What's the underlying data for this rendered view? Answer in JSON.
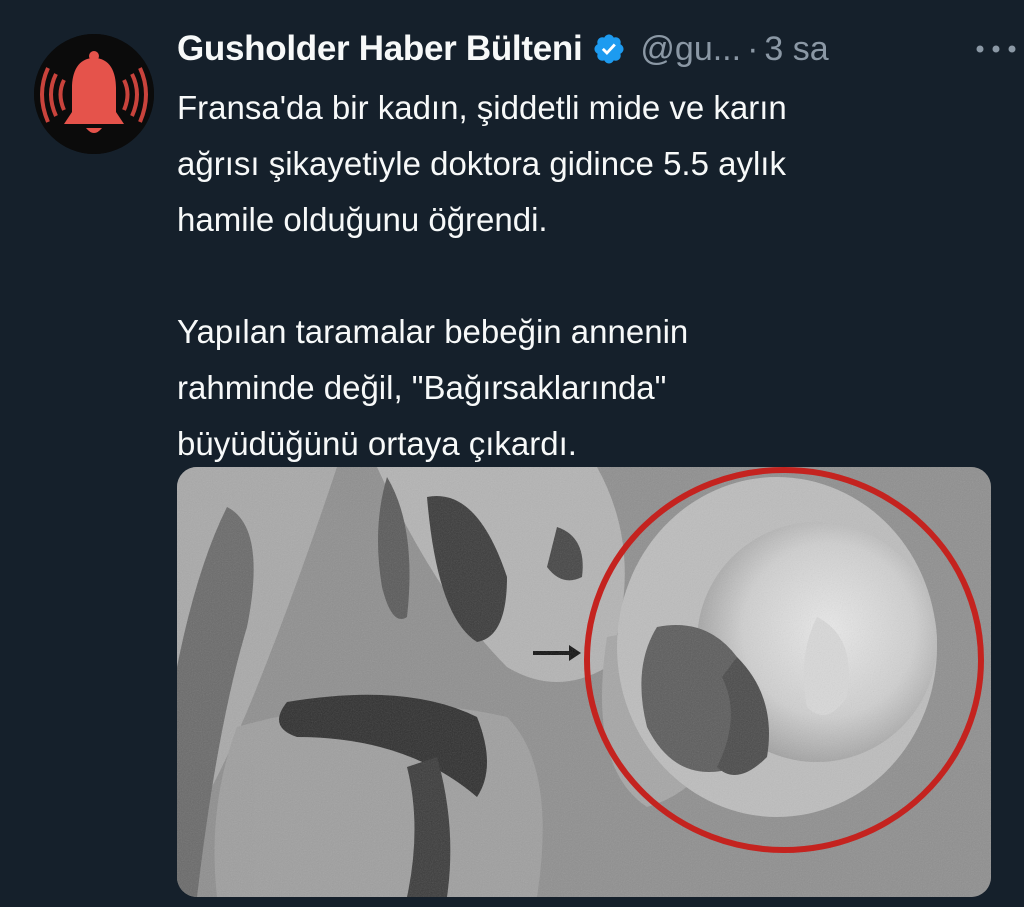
{
  "tweet": {
    "author": {
      "display_name": "Gusholder Haber Bülteni",
      "handle": "@gu...",
      "verified": true,
      "avatar_icon": "bell-icon"
    },
    "separator": "·",
    "time": "3 sa",
    "more_icon": "more-horizontal-icon",
    "text_lines": [
      "Fransa'da bir kadın, şiddetli mide ve karın",
      "ağrısı şikayetiyle doktora gidince 5.5 aylık",
      "hamile olduğunu öğrendi.",
      "",
      "Yapılan taramalar bebeğin annenin",
      "rahminde değil, \"Bağırsaklarında\"",
      "büyüdüğünü ortaya çıkardı."
    ],
    "media": {
      "type": "mri-scan-image",
      "highlight_color": "#c4231f"
    }
  },
  "colors": {
    "background": "#15202b",
    "primary_text": "#f7f9f9",
    "secondary_text": "#8b98a5",
    "verified_badge": "#1d9bf0",
    "avatar_bell": "#e5534b"
  }
}
